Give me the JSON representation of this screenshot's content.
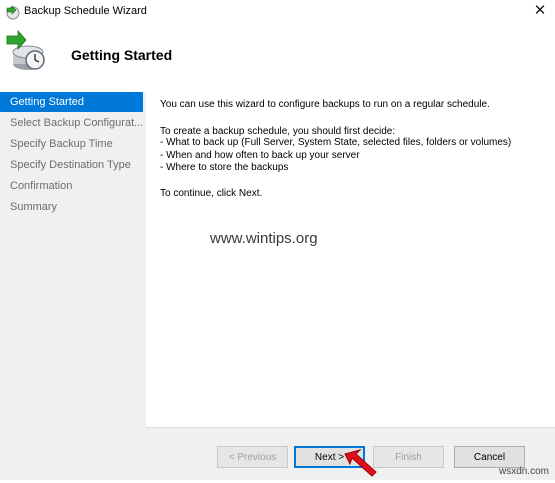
{
  "window": {
    "title": "Backup Schedule Wizard",
    "close_symbol": "✕",
    "icon": "backup-wizard-icon"
  },
  "header": {
    "heading": "Getting Started",
    "icon": "backup-clock-icon"
  },
  "sidebar": {
    "items": [
      {
        "label": "Getting Started",
        "active": true
      },
      {
        "label": "Select Backup Configurat...",
        "active": false
      },
      {
        "label": "Specify Backup Time",
        "active": false
      },
      {
        "label": "Specify Destination Type",
        "active": false
      },
      {
        "label": "Confirmation",
        "active": false
      },
      {
        "label": "Summary",
        "active": false
      }
    ]
  },
  "content": {
    "intro": "You can use this wizard to configure backups to run on a regular schedule.",
    "decide_heading": "To create a backup schedule, you should first decide:",
    "bullets": [
      "-  What to back up (Full Server, System State, selected files, folders or volumes)",
      "-  When and how often to back up your server",
      "-  Where to store the backups"
    ],
    "continue_text": "To continue, click Next."
  },
  "watermark": "www.wintips.org",
  "buttons": {
    "previous": "< Previous",
    "next": "Next >",
    "finish": "Finish",
    "cancel": "Cancel"
  },
  "site_mark": "wsxdn.com",
  "colors": {
    "accent": "#0078d7",
    "sidebar_bg": "#f0f0f0",
    "arrow_red": "#e0101a"
  }
}
